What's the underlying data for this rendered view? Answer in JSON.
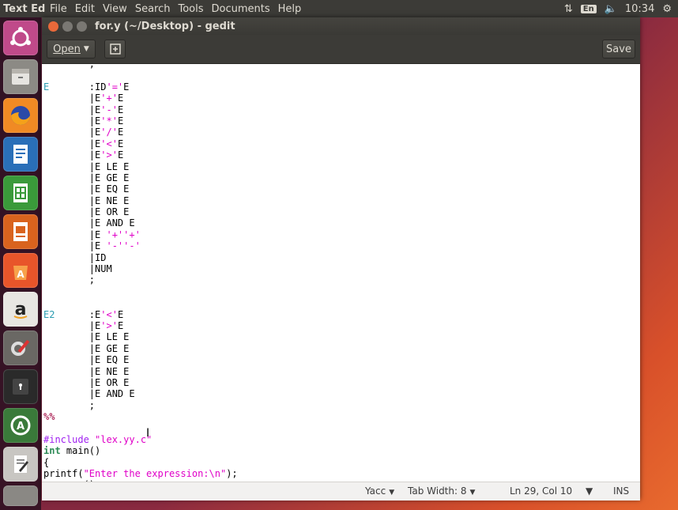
{
  "top_panel": {
    "app_name": "Text Editor",
    "menus": [
      "File",
      "Edit",
      "View",
      "Search",
      "Tools",
      "Documents",
      "Help"
    ],
    "keyboard": "En",
    "time": "10:34"
  },
  "window": {
    "title": "for.y (~/Desktop) - gedit",
    "toolbar": {
      "open_label": "Open",
      "save_label": "Save"
    }
  },
  "editor": {
    "lines": [
      [
        {
          "t": "        ;"
        }
      ],
      [
        {
          "t": ""
        }
      ],
      [
        {
          "t": "E",
          "c": "kw"
        },
        {
          "t": "       :ID"
        },
        {
          "t": "'='",
          "c": "str"
        },
        {
          "t": "E"
        }
      ],
      [
        {
          "t": "        |E"
        },
        {
          "t": "'+'",
          "c": "str"
        },
        {
          "t": "E"
        }
      ],
      [
        {
          "t": "        |E"
        },
        {
          "t": "'-'",
          "c": "str"
        },
        {
          "t": "E"
        }
      ],
      [
        {
          "t": "        |E"
        },
        {
          "t": "'*'",
          "c": "str"
        },
        {
          "t": "E"
        }
      ],
      [
        {
          "t": "        |E"
        },
        {
          "t": "'/'",
          "c": "str"
        },
        {
          "t": "E"
        }
      ],
      [
        {
          "t": "        |E"
        },
        {
          "t": "'<'",
          "c": "str"
        },
        {
          "t": "E"
        }
      ],
      [
        {
          "t": "        |E"
        },
        {
          "t": "'>'",
          "c": "str"
        },
        {
          "t": "E"
        }
      ],
      [
        {
          "t": "        |E LE E"
        }
      ],
      [
        {
          "t": "        |E GE E"
        }
      ],
      [
        {
          "t": "        |E EQ E"
        }
      ],
      [
        {
          "t": "        |E NE E"
        }
      ],
      [
        {
          "t": "        |E OR E"
        }
      ],
      [
        {
          "t": "        |E AND E"
        }
      ],
      [
        {
          "t": "        |E "
        },
        {
          "t": "'+''+'",
          "c": "str"
        }
      ],
      [
        {
          "t": "        |E "
        },
        {
          "t": "'-''-'",
          "c": "str"
        }
      ],
      [
        {
          "t": "        |ID"
        }
      ],
      [
        {
          "t": "        |NUM"
        }
      ],
      [
        {
          "t": "        ;"
        }
      ],
      [
        {
          "t": ""
        }
      ],
      [
        {
          "t": ""
        }
      ],
      [
        {
          "t": "E2",
          "c": "kw"
        },
        {
          "t": "      :E"
        },
        {
          "t": "'<'",
          "c": "str"
        },
        {
          "t": "E"
        }
      ],
      [
        {
          "t": "        |E"
        },
        {
          "t": "'>'",
          "c": "str"
        },
        {
          "t": "E"
        }
      ],
      [
        {
          "t": "        |E LE E"
        }
      ],
      [
        {
          "t": "        |E GE E"
        }
      ],
      [
        {
          "t": "        |E EQ E"
        }
      ],
      [
        {
          "t": "        |E NE E"
        }
      ],
      [
        {
          "t": "        |E OR E"
        }
      ],
      [
        {
          "t": "        |E AND E"
        }
      ],
      [
        {
          "t": "        ;"
        }
      ],
      [
        {
          "t": "%%",
          "c": "pct"
        }
      ],
      [
        {
          "t": ""
        }
      ],
      [
        {
          "t": "#include ",
          "c": "pp"
        },
        {
          "t": "\"lex.yy.c\"",
          "c": "str"
        }
      ],
      [
        {
          "t": "int",
          "c": "type"
        },
        {
          "t": " main()"
        }
      ],
      [
        {
          "t": "{"
        }
      ],
      [
        {
          "t": "printf("
        },
        {
          "t": "\"Enter the expression:\\n\"",
          "c": "str"
        },
        {
          "t": ");"
        }
      ],
      [
        {
          "t": "yyparse();"
        }
      ],
      [
        {
          "t": "}"
        }
      ]
    ]
  },
  "statusbar": {
    "language": "Yacc",
    "tab_width": "Tab Width: 8",
    "position": "Ln 29, Col 10",
    "mode": "INS"
  },
  "colors": {
    "accent": "#e8693a",
    "keyword": "#2a9bb0",
    "string": "#e000c8"
  }
}
